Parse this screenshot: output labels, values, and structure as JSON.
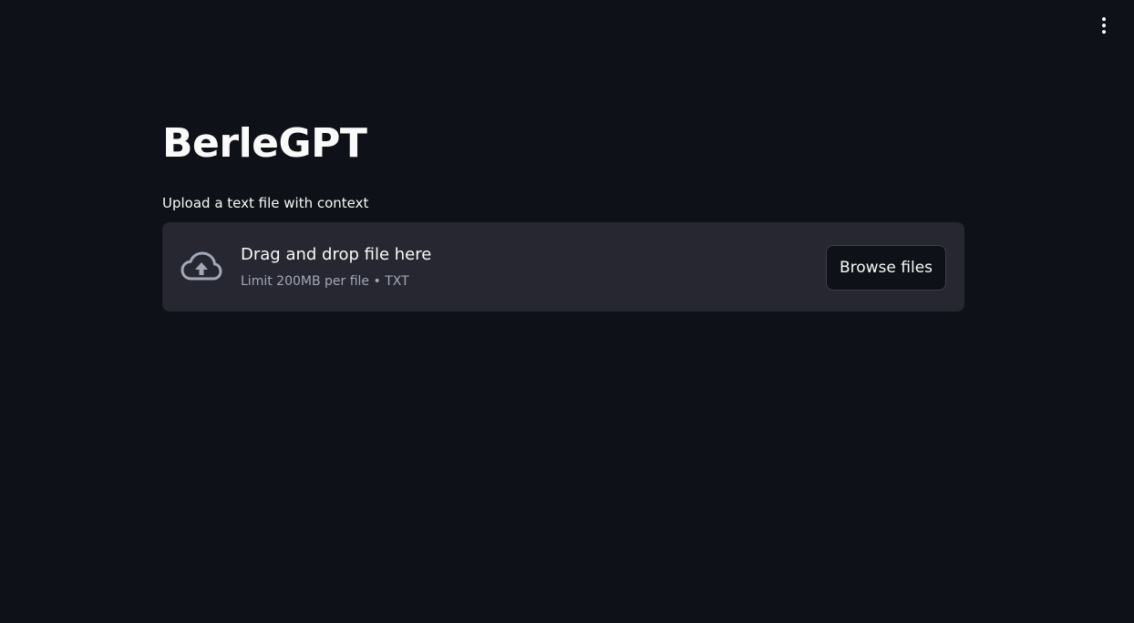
{
  "header": {
    "menu_icon": "vertical-ellipsis-icon"
  },
  "main": {
    "title": "BerleGPT",
    "uploader": {
      "label": "Upload a text file with context",
      "dropzone_main": "Drag and drop file here",
      "dropzone_sub": "Limit 200MB per file • TXT",
      "upload_icon": "cloud-upload-icon",
      "browse_label": "Browse files"
    }
  },
  "colors": {
    "background": "#0e1117",
    "dropzone_bg": "#262730",
    "text": "#fafafa",
    "muted_text": "#a3a8b8",
    "icon": "#a3a8b8"
  }
}
